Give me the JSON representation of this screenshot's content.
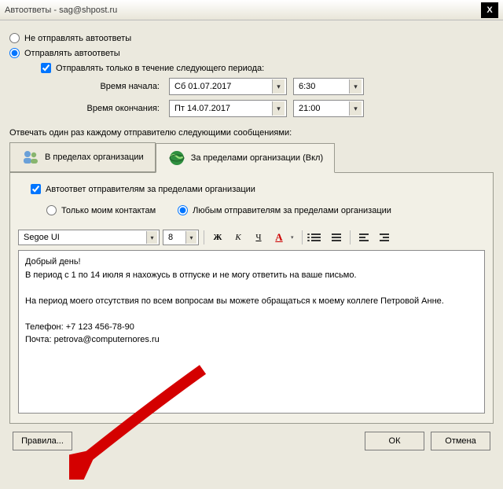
{
  "title": "Автоответы - sag@shpost.ru",
  "close_x": "X",
  "radio_off": "Не отправлять автоответы",
  "radio_on": "Отправлять автоответы",
  "check_period": "Отправлять только в течение следующего периода:",
  "period": {
    "start_label": "Время начала:",
    "start_date": "Сб 01.07.2017",
    "start_time": "6:30",
    "end_label": "Время окончания:",
    "end_date": "Пт 14.07.2017",
    "end_time": "21:00"
  },
  "reply_label": "Отвечать один раз каждому отправителю следующими сообщениями:",
  "tabs": {
    "inside": "В пределах организации",
    "outside": "За пределами организации (Вкл)"
  },
  "panel": {
    "autoresp_check": "Автоответ отправителям за пределами организации",
    "contacts_only": "Только моим контактам",
    "any_sender": "Любым отправителям за пределами организации"
  },
  "toolbar": {
    "font": "Segoe UI",
    "size": "8",
    "bold": "Ж",
    "italic": "К",
    "underline": "Ч",
    "color": "А"
  },
  "message": "Добрый день!\nВ период с 1 по 14 июля я нахожусь в отпуске и не могу ответить на ваше письмо.\n\nНа период моего отсутствия по всем вопросам вы можете обращаться к моему коллеге Петровой Анне.\n\nТелефон: +7 123 456-78-90\nПочта: petrova@computernores.ru",
  "buttons": {
    "rules": "Правила...",
    "ok": "ОК",
    "cancel": "Отмена"
  }
}
